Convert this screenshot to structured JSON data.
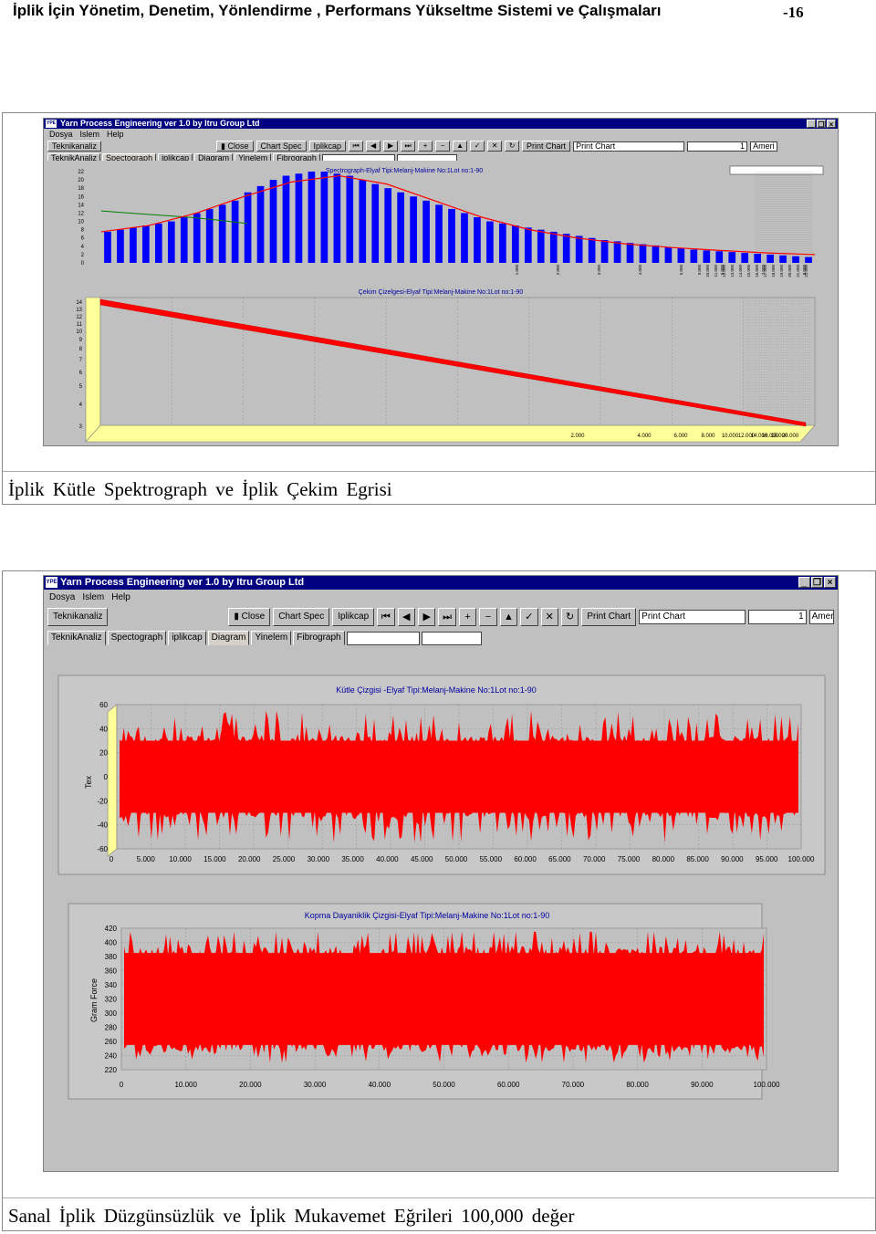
{
  "header": {
    "title": "İplik  İçin  Yönetim,  Denetim, Yönlendirme , Performans  Yükseltme    Sistemi  ve  Çalışmaları",
    "page_number": "-16"
  },
  "captions": {
    "figure1": "İplik  Kütle  Spektrograph  ve   İplik  Çekim  Egrisi",
    "figure2": "Sanal   İplik  Düzgünsüzlük  ve  İplik   Mukavemet   Eğrileri  100,000  değer"
  },
  "app": {
    "title": "Yarn Process Engineering ver 1.0 by Itru  Group Ltd",
    "logo": "YPE",
    "menu": [
      "Dosya",
      "Islem",
      "Help"
    ],
    "toolbar": {
      "teknikanaliz": "Teknikanaliz",
      "close": "Close",
      "chart_spec": "Chart Spec",
      "iplikcap": "Iplikcap",
      "print_chart": "Print Chart",
      "print_combo": "Print Chart",
      "number": "1",
      "country": "Ameri"
    },
    "tabs": [
      "TeknikAnaliz",
      "Spectograph",
      "iplikcap",
      "Diagram",
      "Yinelem",
      "Fibrograph"
    ],
    "nav_icons": [
      "⏮",
      "◀",
      "▶",
      "⏭",
      "+",
      "−",
      "▲",
      "✓",
      "✕",
      "↻"
    ]
  },
  "chart_data": [
    {
      "type": "bar",
      "title": "Spectrograph-Elyaf Tipi:Melanj-Makine No:1Lot no:1-90",
      "ylim": [
        0,
        22
      ],
      "y_ticks": [
        "22",
        "20",
        "18",
        "16",
        "14",
        "12",
        "10",
        "8",
        "6",
        "4",
        "2",
        "0"
      ],
      "x_tick_labels": [
        "1.000",
        "2.000",
        "3.000",
        "4.000",
        "5.000",
        "6.000",
        "7.000",
        "8.000",
        "9.000",
        "10.000",
        "11.000",
        "12.000",
        "13.000",
        "14.000",
        "15.000",
        "16.000",
        "17.000",
        "18.000",
        "19.000",
        "20.000",
        "21.000",
        "22.000"
      ],
      "values": [
        7.5,
        8,
        8.5,
        9,
        9.5,
        10,
        11,
        12,
        13,
        14,
        15,
        17,
        18.5,
        20,
        21,
        21.5,
        22,
        22,
        21.5,
        21,
        20,
        19,
        18,
        17,
        16,
        15,
        14,
        13,
        12,
        11,
        10,
        9.5,
        9,
        8.5,
        8,
        7.5,
        7,
        6.5,
        6,
        5.5,
        5.2,
        4.8,
        4.5,
        4.2,
        3.8,
        3.5,
        3.2,
        3,
        2.8,
        2.6,
        2.4,
        2.2,
        2,
        1.8,
        1.6,
        1.4
      ],
      "series": [
        {
          "values": [
            12.5,
            12,
            11.5,
            11,
            10.3,
            9.5
          ]
        },
        {
          "values": [
            7.5,
            9,
            12,
            16,
            19.5,
            21,
            19,
            15,
            11,
            8,
            6,
            4.6,
            3.7,
            3,
            2.4,
            2
          ]
        }
      ]
    },
    {
      "type": "line",
      "title": "Çekim Çizelgesi-Elyaf Tipi:Melanj-Makine No:1Lot no:1-90",
      "y_ticks": [
        "14",
        "13",
        "12",
        "11",
        "10",
        "9",
        "8",
        "7",
        "6",
        "5",
        "4",
        "3"
      ],
      "x_tick_labels": [
        "2.000",
        "4.000",
        "6.000",
        "8.000",
        "10.000",
        "12.000",
        "14.000",
        "16.000",
        "18.000",
        "20.000"
      ],
      "x": [
        0,
        20000
      ],
      "values": [
        14,
        3
      ]
    },
    {
      "type": "line",
      "title": "Kütle Çizgisi  -Elyaf Tipi:Melanj-Makine No:1Lot no:1-90",
      "ylabel": "Tex",
      "ylim": [
        -60,
        60
      ],
      "y_ticks": [
        "60",
        "40",
        "20",
        "0",
        "-20",
        "-40",
        "-60"
      ],
      "x_ticks": [
        "0",
        "5.000",
        "10.000",
        "15.000",
        "20.000",
        "25.000",
        "30.000",
        "35.000",
        "40.000",
        "45.000",
        "50.000",
        "55.000",
        "60.000",
        "65.000",
        "70.000",
        "75.000",
        "80.000",
        "85.000",
        "90.000",
        "95.000",
        "100.000"
      ],
      "xlim": [
        0,
        100000
      ],
      "band": {
        "mean": 0,
        "typical_min": -30,
        "typical_max": 30,
        "peak_min": -55,
        "peak_max": 55
      }
    },
    {
      "type": "line",
      "title": "Kopma  Dayaniklik Çizgisi-Elyaf Tipi:Melanj-Makine No:1Lot no:1-90",
      "ylabel": "Gram Force",
      "ylim": [
        220,
        420
      ],
      "y_ticks": [
        "420",
        "400",
        "380",
        "360",
        "340",
        "320",
        "300",
        "280",
        "260",
        "240",
        "220"
      ],
      "x_ticks": [
        "0",
        "10.000",
        "20.000",
        "30.000",
        "40.000",
        "50.000",
        "60.000",
        "70.000",
        "80.000",
        "90.000",
        "100.000"
      ],
      "xlim": [
        0,
        100000
      ],
      "band": {
        "mean": 320,
        "typical_min": 255,
        "typical_max": 385,
        "peak_min": 230,
        "peak_max": 415
      }
    }
  ],
  "colors": {
    "bar": "#0000ff",
    "fit_line": "#ff0000",
    "trend_line": "#008000",
    "signal": "#ff0000",
    "window_title": "#000080",
    "chrome": "#c0c0c0"
  }
}
